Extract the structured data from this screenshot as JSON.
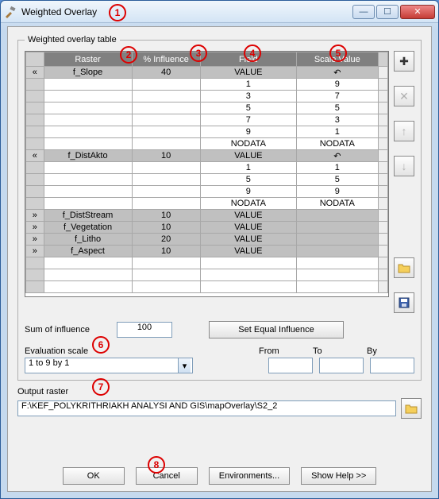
{
  "window": {
    "title": "Weighted Overlay"
  },
  "fieldset": {
    "legend": "Weighted overlay table"
  },
  "table": {
    "headers": {
      "raster": "Raster",
      "influence": "% Influence",
      "field": "Field",
      "scale": "Scale Value"
    },
    "rows": [
      {
        "icon": "«",
        "raster": "f_Slope",
        "influence": "40",
        "field": "VALUE",
        "scale": "↶",
        "shade": true
      },
      {
        "icon": "",
        "raster": "",
        "influence": "",
        "field": "1",
        "scale": "9"
      },
      {
        "icon": "",
        "raster": "",
        "influence": "",
        "field": "3",
        "scale": "7"
      },
      {
        "icon": "",
        "raster": "",
        "influence": "",
        "field": "5",
        "scale": "5"
      },
      {
        "icon": "",
        "raster": "",
        "influence": "",
        "field": "7",
        "scale": "3"
      },
      {
        "icon": "",
        "raster": "",
        "influence": "",
        "field": "9",
        "scale": "1"
      },
      {
        "icon": "",
        "raster": "",
        "influence": "",
        "field": "NODATA",
        "scale": "NODATA"
      },
      {
        "icon": "«",
        "raster": "f_DistAkto",
        "influence": "10",
        "field": "VALUE",
        "scale": "↶",
        "shade": true
      },
      {
        "icon": "",
        "raster": "",
        "influence": "",
        "field": "1",
        "scale": "1"
      },
      {
        "icon": "",
        "raster": "",
        "influence": "",
        "field": "5",
        "scale": "5"
      },
      {
        "icon": "",
        "raster": "",
        "influence": "",
        "field": "9",
        "scale": "9"
      },
      {
        "icon": "",
        "raster": "",
        "influence": "",
        "field": "NODATA",
        "scale": "NODATA"
      },
      {
        "icon": "»",
        "raster": "f_DistStream",
        "influence": "10",
        "field": "VALUE",
        "scale": "",
        "shade": true
      },
      {
        "icon": "»",
        "raster": "f_Vegetation",
        "influence": "10",
        "field": "VALUE",
        "scale": "",
        "shade": true
      },
      {
        "icon": "»",
        "raster": "f_Litho",
        "influence": "20",
        "field": "VALUE",
        "scale": "",
        "shade": true
      },
      {
        "icon": "»",
        "raster": "f_Aspect",
        "influence": "10",
        "field": "VALUE",
        "scale": "",
        "shade": true
      }
    ]
  },
  "side": {
    "add": "✚",
    "delete": "✕",
    "up": "↑",
    "down": "↓"
  },
  "sum": {
    "label": "Sum of influence",
    "value": "100",
    "setEqual": "Set Equal Influence"
  },
  "eval": {
    "label": "Evaluation scale",
    "value": "1 to 9 by 1",
    "from": "From",
    "to": "To",
    "by": "By",
    "fromVal": "",
    "toVal": "",
    "byVal": ""
  },
  "output": {
    "label": "Output raster",
    "path": "F:\\KEF_POLYKRITHRIAKH ANALYSI AND GIS\\mapOverlay\\S2_2"
  },
  "buttons": {
    "ok": "OK",
    "cancel": "Cancel",
    "env": "Environments...",
    "help": "Show Help >>"
  },
  "annotations": {
    "1": "1",
    "2": "2",
    "3": "3",
    "4": "4",
    "5": "5",
    "6": "6",
    "7": "7",
    "8": "8"
  }
}
